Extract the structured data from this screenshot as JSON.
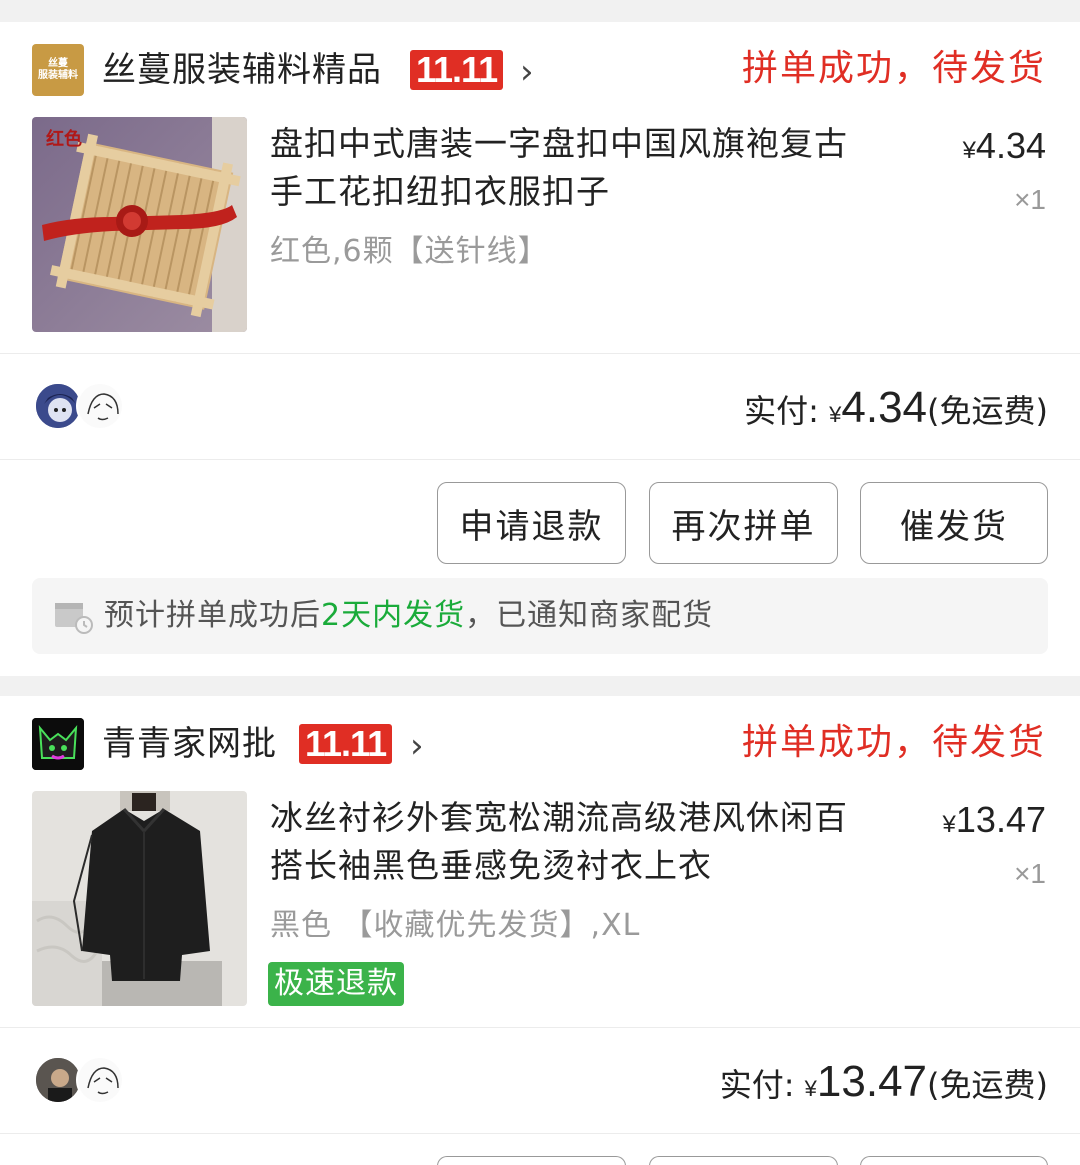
{
  "orders": [
    {
      "shop_logo_text": [
        "丝蔓",
        "服装辅料"
      ],
      "shop_name": "丝蔓服装辅料精品",
      "badge": "11.11",
      "status": "拼单成功，待发货",
      "product_title_line1": "盘扣中式唐装一字盘扣中国风旗袍复古",
      "product_title_line2": "手工花扣纽扣衣服扣子",
      "spec": "红色,6颗【送针线】",
      "thumb_label": "红色",
      "price_symbol": "¥",
      "price": "4.34",
      "qty": "×1",
      "paid_label": "实付:",
      "paid_symbol": "¥",
      "paid_amount": "4.34",
      "paid_note": "(免运费)",
      "buttons": [
        "申请退款",
        "再次拼单",
        "催发货"
      ],
      "notice_prefix": "预计拼单成功后",
      "notice_highlight": "2天内发货",
      "notice_suffix": "，已通知商家配货"
    },
    {
      "shop_name": "青青家网批",
      "badge": "11.11",
      "status": "拼单成功，待发货",
      "product_title_line1": "冰丝衬衫外套宽松潮流高级港风休闲百",
      "product_title_line2": "搭长袖黑色垂感免烫衬衣上衣",
      "spec": "黑色 【收藏优先发货】,XL",
      "fast_refund": "极速退款",
      "price_symbol": "¥",
      "price": "13.47",
      "qty": "×1",
      "paid_label": "实付:",
      "paid_symbol": "¥",
      "paid_amount": "13.47",
      "paid_note": "(免运费)"
    }
  ],
  "colors": {
    "accent_red": "#e02e24",
    "green": "#1aab3a",
    "refund_green": "#3bb34a",
    "muted": "#9a9a9a"
  }
}
